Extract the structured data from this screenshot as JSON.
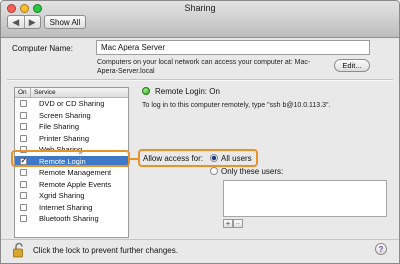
{
  "window": {
    "title": "Sharing"
  },
  "toolbar": {
    "back_glyph": "◀",
    "forward_glyph": "▶",
    "show_all": "Show All"
  },
  "computer_name": {
    "label": "Computer Name:",
    "value": "Mac Apera Server",
    "description": "Computers on your local network can access your computer at: Mac-Apera-Server.local",
    "edit_button": "Edit..."
  },
  "services": {
    "header_on": "On",
    "header_service": "Service",
    "items": [
      {
        "label": "DVD or CD Sharing",
        "checked": false
      },
      {
        "label": "Screen Sharing",
        "checked": false
      },
      {
        "label": "File Sharing",
        "checked": false
      },
      {
        "label": "Printer Sharing",
        "checked": false
      },
      {
        "label": "Web Sharing",
        "checked": false
      },
      {
        "label": "Remote Login",
        "checked": true,
        "selected": true
      },
      {
        "label": "Remote Management",
        "checked": false
      },
      {
        "label": "Remote Apple Events",
        "checked": false
      },
      {
        "label": "Xgrid Sharing",
        "checked": false
      },
      {
        "label": "Internet Sharing",
        "checked": false
      },
      {
        "label": "Bluetooth Sharing",
        "checked": false
      }
    ]
  },
  "detail": {
    "status": "Remote Login: On",
    "info": "To log in to this computer remotely, type \"ssh b@10.0.113.3\".",
    "allow_label": "Allow access for:",
    "option_all": "All users",
    "option_only": "Only these users:",
    "add_glyph": "+",
    "remove_glyph": "−"
  },
  "footer": {
    "lock_text": "Click the lock to prevent further changes.",
    "help_glyph": "?"
  },
  "colors": {
    "highlight": "#e8922c",
    "selection": "#3d78c9",
    "status_green": "#2fa31c"
  }
}
